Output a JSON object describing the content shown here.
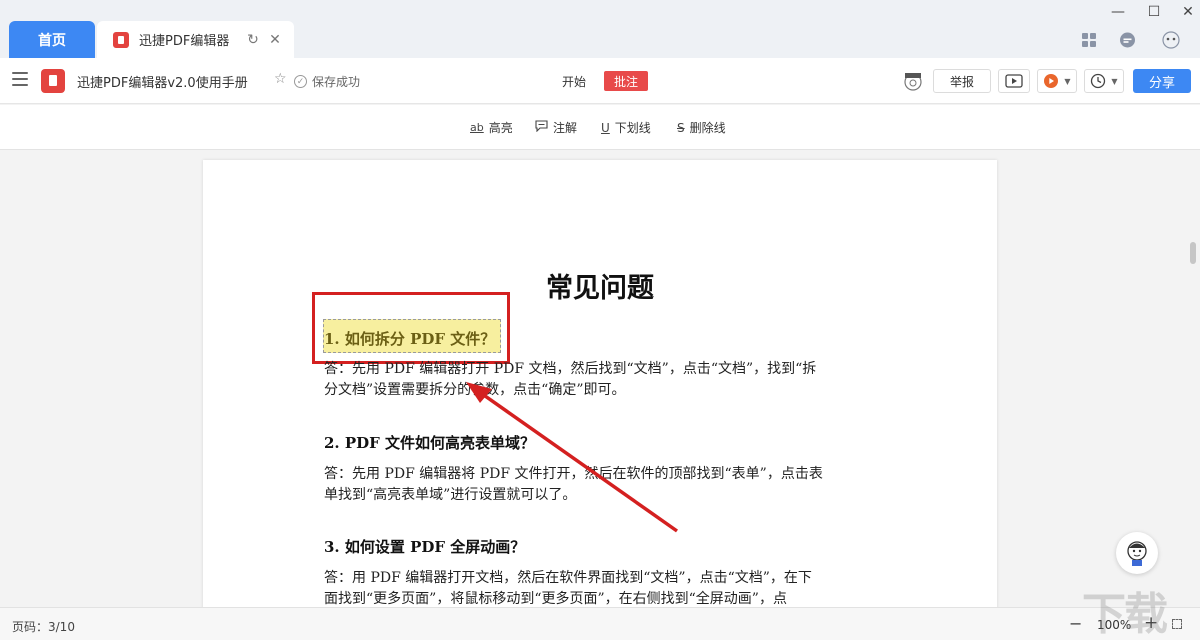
{
  "tabs": {
    "home_label": "首页",
    "doc_label": "迅捷PDF编辑器"
  },
  "toolbar": {
    "doc_title": "迅捷PDF编辑器v2.0使用手册",
    "save_status": "保存成功",
    "nav_start": "开始",
    "nav_annotate": "批注",
    "report_label": "举报",
    "share_label": "分享"
  },
  "annotation_tools": [
    {
      "label": "高亮",
      "icon": "highlight-icon"
    },
    {
      "label": "注解",
      "icon": "comment-icon"
    },
    {
      "label": "下划线",
      "icon": "underline-icon"
    },
    {
      "label": "删除线",
      "icon": "strikethrough-icon"
    }
  ],
  "document": {
    "heading": "常见问题",
    "q1": "1. 如何拆分 PDF 文件？",
    "a1_line1": "答：先用 PDF 编辑器打开 PDF 文档，然后找到“文档”，点击“文档”，找到“拆",
    "a1_line2": "分文档”设置需要拆分的参数，点击“确定”即可。",
    "q2": "2. PDF 文件如何高亮表单域？",
    "a2_line1": "答：先用 PDF 编辑器将 PDF 文件打开，然后在软件的顶部找到“表单”，点击表",
    "a2_line2": "单找到“高亮表单域”进行设置就可以了。",
    "q3": "3. 如何设置 PDF 全屏动画？",
    "a3_line1": "答：用 PDF 编辑器打开文档，然后在软件界面找到“文档”，点击“文档”，在下",
    "a3_line2": "面找到“更多页面”，将鼠标移动到“更多页面”，在右侧找到“全屏动画”，点"
  },
  "status": {
    "page_label": "页码：3/10",
    "zoom": "100%"
  },
  "watermark": "下载吧",
  "colors": {
    "accent": "#3d88f3",
    "annotate_active": "#e84a4a",
    "highlight": "#f7ef9f",
    "callout_red": "#d42020"
  }
}
